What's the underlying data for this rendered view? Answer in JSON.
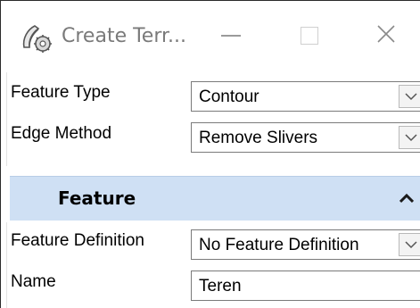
{
  "window": {
    "title": "Create Terr...",
    "icon": "terrain-tool-icon",
    "controls": [
      "minimize-icon",
      "maximize-icon",
      "close-icon"
    ]
  },
  "form": {
    "feature_type": {
      "label": "Feature Type",
      "value": "Contour"
    },
    "edge_method": {
      "label": "Edge Method",
      "value": "Remove Slivers"
    }
  },
  "feature_section": {
    "title": "Feature",
    "collapse_icon": "chevron-up-icon",
    "feature_definition": {
      "label": "Feature Definition",
      "value": "No Feature Definition"
    },
    "name": {
      "label": "Name",
      "value": "Teren"
    }
  },
  "colors": {
    "section_header_bg": "#cfe0f4",
    "title_text": "#7a7a7a"
  }
}
